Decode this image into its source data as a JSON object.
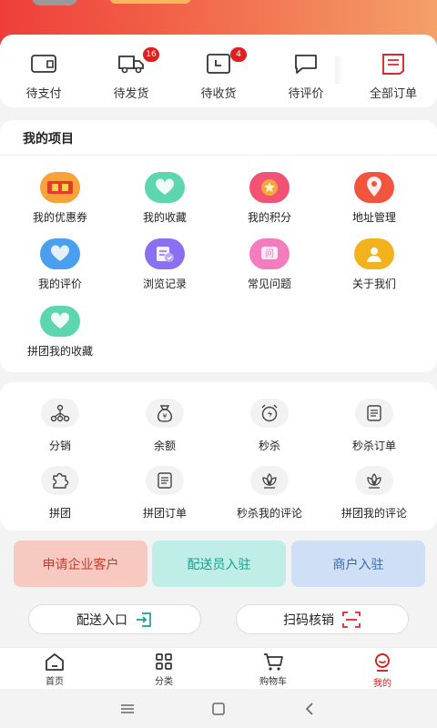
{
  "colors": {
    "accent": "#e02020",
    "tab_active": "#cc2222"
  },
  "orders": [
    {
      "label": "待支付",
      "icon": "wallet-icon",
      "badge": ""
    },
    {
      "label": "待发货",
      "icon": "truck-icon",
      "badge": "16"
    },
    {
      "label": "待收货",
      "icon": "package-icon",
      "badge": "4"
    },
    {
      "label": "待评价",
      "icon": "chat-bubble-icon",
      "badge": ""
    },
    {
      "label": "全部订单",
      "icon": "document-icon",
      "badge": ""
    }
  ],
  "projects": {
    "title": "我的项目",
    "items": [
      {
        "label": "我的优惠券",
        "icon": "coupon-icon"
      },
      {
        "label": "我的收藏",
        "icon": "heart-icon"
      },
      {
        "label": "我的积分",
        "icon": "points-medal-icon"
      },
      {
        "label": "地址管理",
        "icon": "location-pin-icon"
      },
      {
        "label": "我的评价",
        "icon": "heart-review-icon"
      },
      {
        "label": "浏览记录",
        "icon": "history-icon"
      },
      {
        "label": "常见问题",
        "icon": "question-icon"
      },
      {
        "label": "关于我们",
        "icon": "about-us-icon"
      },
      {
        "label": "拼团我的收藏",
        "icon": "heart-icon"
      }
    ]
  },
  "tools": [
    {
      "label": "分销",
      "icon": "distribution-icon"
    },
    {
      "label": "余额",
      "icon": "money-bag-icon"
    },
    {
      "label": "秒杀",
      "icon": "alarm-clock-icon"
    },
    {
      "label": "秒杀订单",
      "icon": "list-icon"
    },
    {
      "label": "拼团",
      "icon": "puzzle-icon"
    },
    {
      "label": "拼团订单",
      "icon": "list-icon"
    },
    {
      "label": "秒杀我的评论",
      "icon": "lotus-icon"
    },
    {
      "label": "拼团我的评论",
      "icon": "lotus-icon"
    }
  ],
  "apply": [
    {
      "label": "申请企业客户",
      "bg": "#f7c9c0",
      "fg": "#d0392b"
    },
    {
      "label": "配送员入驻",
      "bg": "#bfeee6",
      "fg": "#1e9a8a"
    },
    {
      "label": "商户入驻",
      "bg": "#cfe0f6",
      "fg": "#3a68b0"
    }
  ],
  "pills": {
    "delivery": "配送入口",
    "scan": "扫码核销"
  },
  "tabs": [
    {
      "label": "首页",
      "icon": "home-icon"
    },
    {
      "label": "分类",
      "icon": "category-grid-icon"
    },
    {
      "label": "购物车",
      "icon": "cart-icon"
    },
    {
      "label": "我的",
      "icon": "profile-icon",
      "active": true
    }
  ]
}
